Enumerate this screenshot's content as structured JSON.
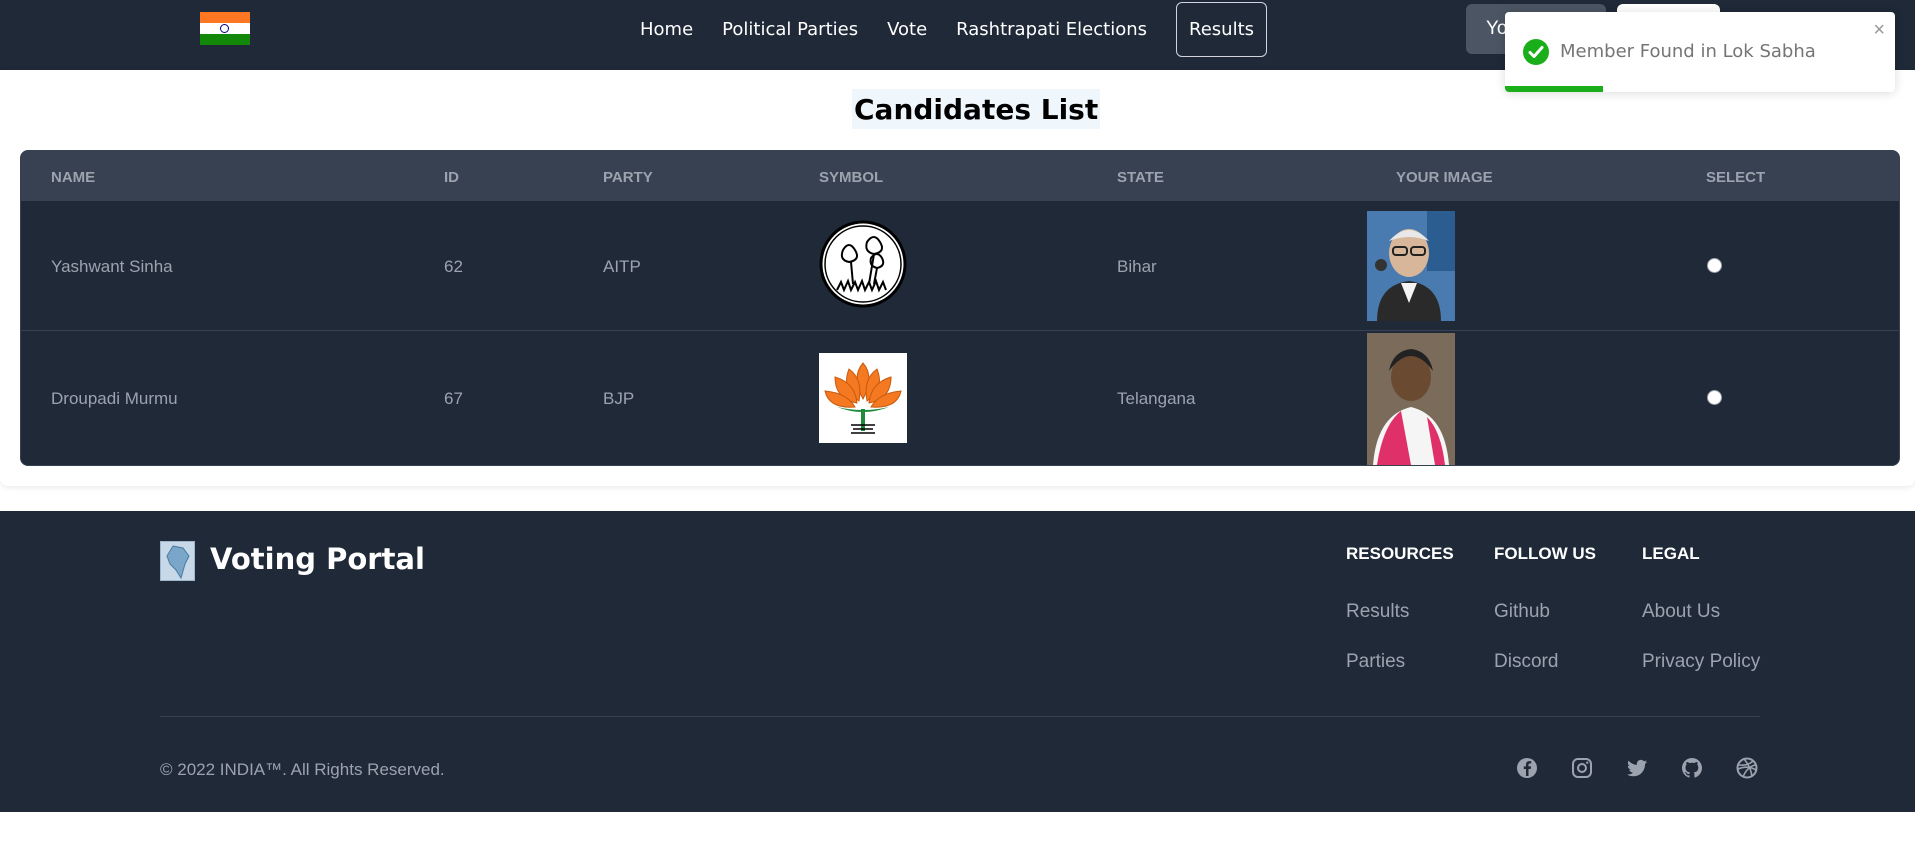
{
  "nav": {
    "flag_icon": "india-flag-icon",
    "links": [
      "Home",
      "Political Parties",
      "Vote",
      "Rashtrapati Elections"
    ],
    "active_link": "Results",
    "button_partial": "Yo"
  },
  "toast": {
    "message": "Member Found in Lok Sabha",
    "close": "×",
    "progress": 0.25,
    "color": "#1aaf1a"
  },
  "page": {
    "title": "Candidates List"
  },
  "table": {
    "headers": [
      "NAME",
      "ID",
      "PARTY",
      "SYMBOL",
      "STATE",
      "YOUR IMAGE",
      "SELECT"
    ],
    "rows": [
      {
        "name": "Yashwant Sinha",
        "id": "62",
        "party": "AITP",
        "symbol": "twin-flowers-symbol",
        "state": "Bihar",
        "image": "candidate-photo",
        "selected": false
      },
      {
        "name": "Droupadi Murmu",
        "id": "67",
        "party": "BJP",
        "symbol": "lotus-symbol",
        "state": "Telangana",
        "image": "candidate-photo",
        "selected": false
      }
    ]
  },
  "footer": {
    "brand": "Voting Portal",
    "columns": [
      {
        "heading": "RESOURCES",
        "links": [
          "Results",
          "Parties"
        ]
      },
      {
        "heading": "FOLLOW US",
        "links": [
          "Github",
          "Discord"
        ]
      },
      {
        "heading": "LEGAL",
        "links": [
          "About Us",
          "Privacy Policy"
        ]
      }
    ],
    "copyright": "© 2022 INDIA™. All Rights Reserved.",
    "socials": [
      "facebook-icon",
      "instagram-icon",
      "twitter-icon",
      "github-icon",
      "dribbble-icon"
    ]
  },
  "colors": {
    "navbar": "#1f2937",
    "table_header": "#374151",
    "muted_text": "#9ca3af"
  }
}
